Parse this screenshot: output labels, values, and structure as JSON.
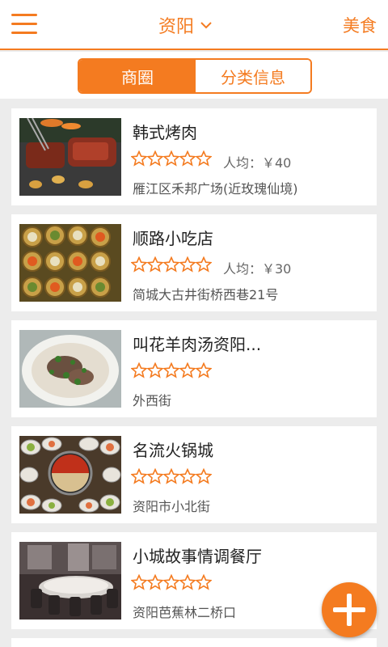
{
  "header": {
    "city": "资阳",
    "category": "美食",
    "menu_icon": "hamburger-menu-icon",
    "dropdown_icon": "chevron-down-icon"
  },
  "tabs": [
    {
      "label": "商圈",
      "active": true
    },
    {
      "label": "分类信息",
      "active": false
    }
  ],
  "colors": {
    "accent": "#f47b20",
    "background": "#ececec"
  },
  "restaurants": [
    {
      "name": "韩式烤肉",
      "rating": 0,
      "avg_price": "人均：￥40",
      "address": "雁江区禾邦广场(近玫瑰仙境)",
      "thumb": "grilled-meat-photo"
    },
    {
      "name": "顺路小吃店",
      "rating": 0,
      "avg_price": "人均：￥30",
      "address": " 简城大古井街桥西巷21号",
      "thumb": "dim-sum-photo"
    },
    {
      "name": " 叫花羊肉汤资阳...",
      "rating": 0,
      "avg_price": "",
      "address": "外西街",
      "thumb": "lamb-soup-photo"
    },
    {
      "name": "名流火锅城",
      "rating": 0,
      "avg_price": "",
      "address": "资阳市小北街",
      "thumb": "hotpot-photo"
    },
    {
      "name": "小城故事情调餐厅",
      "rating": 0,
      "avg_price": "",
      "address": "资阳芭蕉林二桥口",
      "thumb": "restaurant-interior-photo"
    }
  ],
  "fab": {
    "icon": "plus-icon"
  }
}
